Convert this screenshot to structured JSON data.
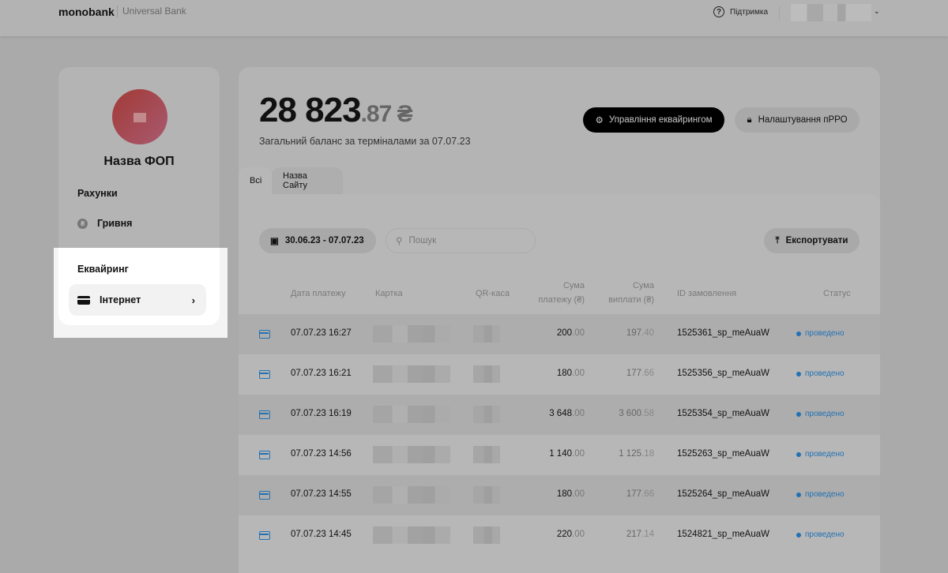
{
  "header": {
    "logo": "monobank",
    "logo_sub": "Universal Bank",
    "support": "Підтримка"
  },
  "sidebar": {
    "company": "Назва ФОП",
    "accounts_title": "Рахунки",
    "uah": "Гривня",
    "uah_symbol": "₴",
    "acquiring_title": "Еквайринг",
    "internet": "Інтернет"
  },
  "balance": {
    "whole": "28 823",
    "decimal": ".87 ₴",
    "subtitle": "Загальний баланс за терміналами за 07.07.23"
  },
  "buttons": {
    "manage": "Управління еквайрингом",
    "prro": "Налаштування пРРО",
    "export": "Експортувати"
  },
  "tabs": [
    "Всі",
    "Назва Сайту"
  ],
  "filters": {
    "date_range": "30.06.23 - 07.07.23",
    "search_placeholder": "Пошук"
  },
  "table": {
    "headers": {
      "date": "Дата платежу",
      "card": "Картка",
      "qr": "QR-каса",
      "pay1": "Сума",
      "pay2": "платежу (₴)",
      "out1": "Сума",
      "out2": "виплати (₴)",
      "order": "ID замовлення",
      "status": "Статус"
    },
    "rows": [
      {
        "date": "07.07.23 16:27",
        "pay": "200",
        "pay_dec": ".00",
        "out": "197",
        "out_dec": ".40",
        "order": "1525361_sp_meAuaW",
        "status": "проведено"
      },
      {
        "date": "07.07.23 16:21",
        "pay": "180",
        "pay_dec": ".00",
        "out": "177",
        "out_dec": ".66",
        "order": "1525356_sp_meAuaW",
        "status": "проведено"
      },
      {
        "date": "07.07.23 16:19",
        "pay": "3 648",
        "pay_dec": ".00",
        "out": "3 600",
        "out_dec": ".58",
        "order": "1525354_sp_meAuaW",
        "status": "проведено"
      },
      {
        "date": "07.07.23 14:56",
        "pay": "1 140",
        "pay_dec": ".00",
        "out": "1 125",
        "out_dec": ".18",
        "order": "1525263_sp_meAuaW",
        "status": "проведено"
      },
      {
        "date": "07.07.23 14:55",
        "pay": "180",
        "pay_dec": ".00",
        "out": "177",
        "out_dec": ".66",
        "order": "1525264_sp_meAuaW",
        "status": "проведено"
      },
      {
        "date": "07.07.23 14:45",
        "pay": "220",
        "pay_dec": ".00",
        "out": "217",
        "out_dec": ".14",
        "order": "1524821_sp_meAuaW",
        "status": "проведено"
      }
    ]
  },
  "colors": {
    "status": "#2271b3",
    "overlay": "#aaaaaa"
  }
}
